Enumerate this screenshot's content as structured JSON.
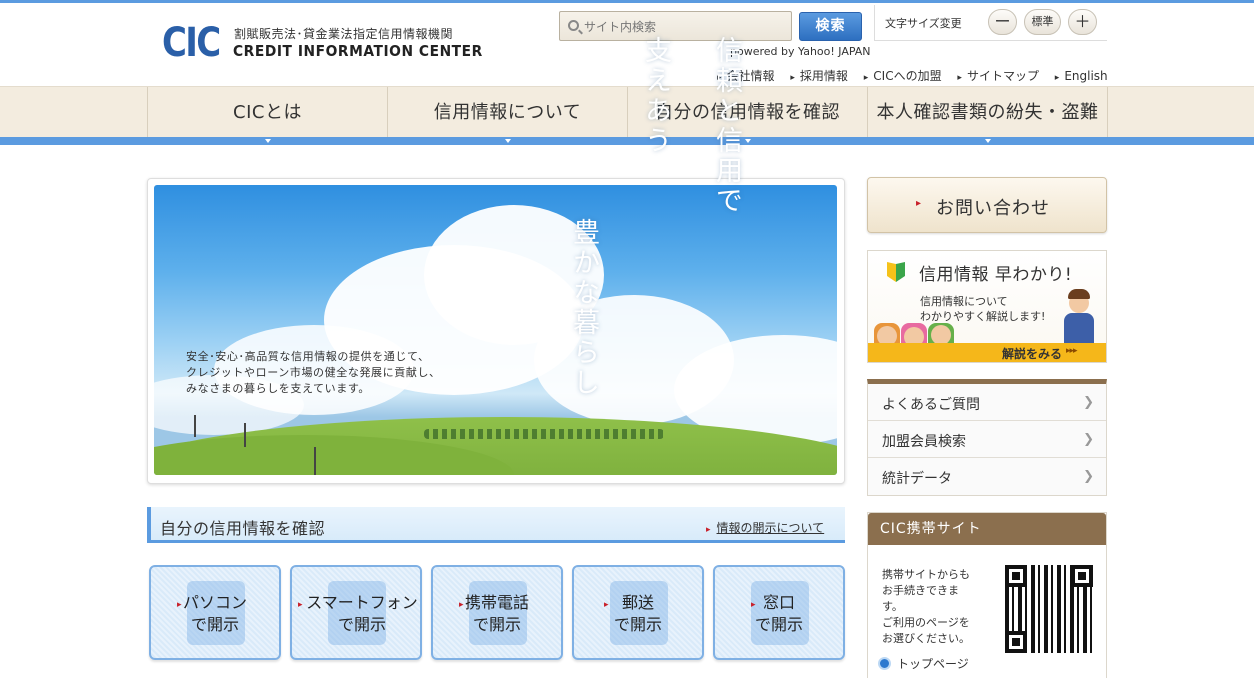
{
  "header": {
    "logo": "CIC",
    "org_sub": "割賦販売法･貸金業法指定信用情報機関",
    "org_name": "CREDIT INFORMATION CENTER",
    "search_placeholder": "サイト内検索",
    "search_button": "検索",
    "powered_by": "powered by Yahoo! JAPAN",
    "fontsize_label": "文字サイズ変更",
    "fontsize_minus": "ー",
    "fontsize_standard": "標準",
    "fontsize_plus": "＋",
    "links": [
      "会社情報",
      "採用情報",
      "CICへの加盟",
      "サイトマップ",
      "English"
    ]
  },
  "gnav": {
    "items": [
      "CICとは",
      "信用情報について",
      "自分の信用情報を確認",
      "本人確認書類の紛失・盗難"
    ]
  },
  "hero": {
    "vertical": [
      "信頼と信用で",
      "支えあう",
      "豊かな暮らし"
    ],
    "text": "安全･安心･高品質な信用情報の提供を通じて、\nクレジットやローン市場の健全な発展に貢献し、\nみなさまの暮らしを支えています。"
  },
  "section": {
    "title": "自分の信用情報を確認",
    "link": "情報の開示について"
  },
  "disclosure_buttons": [
    {
      "line1": "パソコン",
      "line2": "で開示"
    },
    {
      "line1": "スマートフォン",
      "line2": "で開示"
    },
    {
      "line1": "携帯電話",
      "line2": "で開示"
    },
    {
      "line1": "郵送",
      "line2": "で開示"
    },
    {
      "line1": "窓口",
      "line2": "で開示"
    }
  ],
  "sidebar": {
    "contact": "お問い合わせ",
    "banner_title": "信用情報 早わかり!",
    "banner_sub": "信用情報について\nわかりやすく解説します!",
    "banner_cta": "解説をみる",
    "menu": [
      "よくあるご質問",
      "加盟会員検索",
      "統計データ"
    ],
    "mobile_title": "CIC携帯サイト",
    "mobile_text": "携帯サイトからも\nお手続きできま\nす。\nご利用のページを\nお選びください。",
    "mobile_option": "トップページ"
  },
  "colors": {
    "accent_blue": "#5b9be0",
    "nav_bg": "#f3ecdf",
    "brown": "#8b6f4e",
    "banner_yellow": "#f5b71a",
    "red_marker": "#c8202a"
  }
}
